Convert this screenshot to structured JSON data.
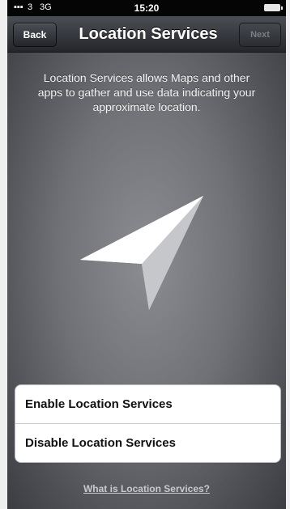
{
  "status_bar": {
    "carrier": "3",
    "network": "3G",
    "time": "15:20"
  },
  "nav": {
    "back_label": "Back",
    "title": "Location Services",
    "next_label": "Next"
  },
  "description": "Location Services allows Maps and other apps to gather and use data indicating your approximate location.",
  "options": [
    {
      "label": "Enable Location Services"
    },
    {
      "label": "Disable Location Services"
    }
  ],
  "help_link": "What is Location Services?",
  "icons": [
    "signal-icon",
    "battery-icon",
    "location-arrow-icon"
  ]
}
